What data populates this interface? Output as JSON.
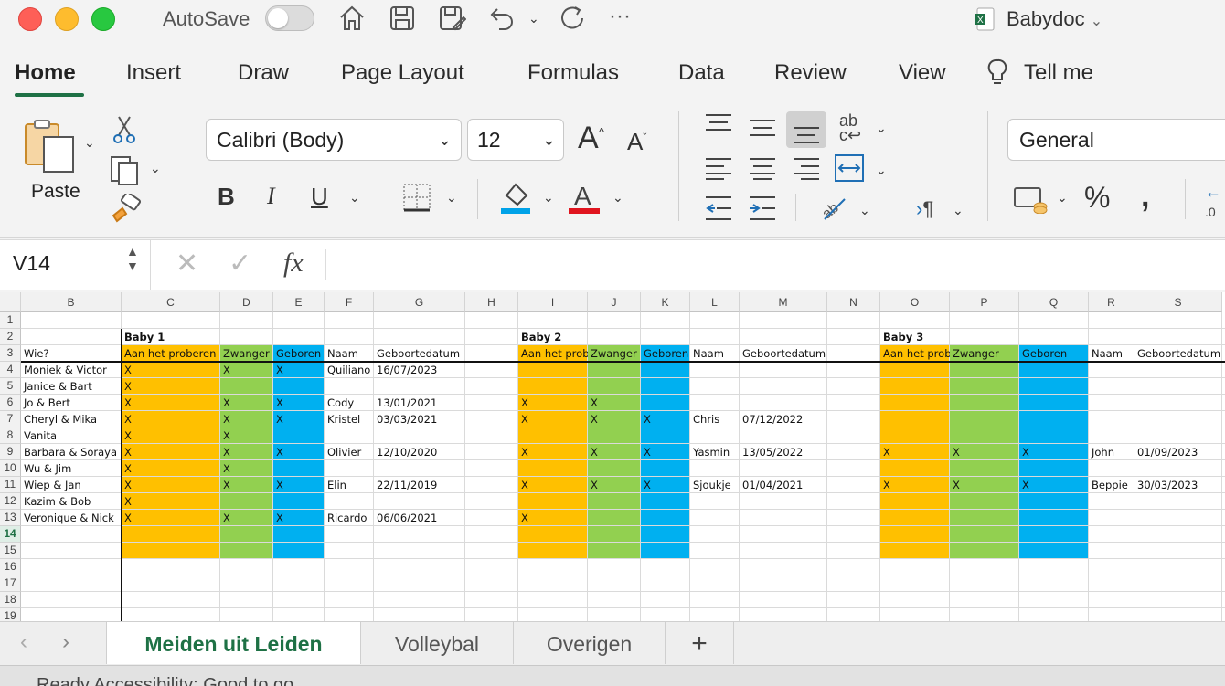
{
  "window": {
    "autosave_label": "AutoSave",
    "doc_title": "Babydoc",
    "ribbon_tabs": [
      "Home",
      "Insert",
      "Draw",
      "Page Layout",
      "Formulas",
      "Data",
      "Review",
      "View",
      "Tell me"
    ]
  },
  "ribbon": {
    "paste_label": "Paste",
    "font_name": "Calibri (Body)",
    "font_size": "12",
    "number_format": "General",
    "underline_color": "#e0141e",
    "fill_color": "#00a2e8"
  },
  "formula_bar": {
    "cell_ref": "V14",
    "fx": "fx",
    "value": ""
  },
  "columns": [
    "B",
    "C",
    "D",
    "E",
    "F",
    "G",
    "H",
    "I",
    "J",
    "K",
    "L",
    "M",
    "N",
    "O",
    "P",
    "Q",
    "R",
    "S"
  ],
  "rows": [
    "1",
    "2",
    "3",
    "4",
    "5",
    "6",
    "7",
    "8",
    "9",
    "10",
    "11",
    "12",
    "13",
    "14",
    "15",
    "16",
    "17",
    "18",
    "19"
  ],
  "selected_row": "14",
  "colors": {
    "orange": "#ffc000",
    "green": "#92d050",
    "blue": "#00b0f0",
    "accent": "#1e7145"
  },
  "cells": {
    "C2": "Baby 1",
    "I2": "Baby 2",
    "O2": "Baby 3",
    "B3": "Wie?",
    "C3": "Aan het proberen",
    "D3": "Zwanger",
    "E3": "Geboren",
    "F3": "Naam",
    "G3": "Geboortedatum",
    "I3": "Aan het proberen",
    "J3": "Zwanger",
    "K3": "Geboren",
    "L3": "Naam",
    "M3": "Geboortedatum",
    "O3": "Aan het proberen",
    "P3": "Zwanger",
    "Q3": "Geboren",
    "R3": "Naam",
    "S3": "Geboortedatum",
    "B4": "Moniek & Victor",
    "C4": "X",
    "D4": "X",
    "E4": "X",
    "F4": "Quiliano",
    "G4": "16/07/2023",
    "B5": "Janice & Bart",
    "C5": "X",
    "B6": "Jo & Bert",
    "C6": "X",
    "D6": "X",
    "E6": "X",
    "F6": "Cody",
    "G6": "13/01/2021",
    "I6": "X",
    "J6": "X",
    "B7": "Cheryl & Mika",
    "C7": "X",
    "D7": "X",
    "E7": "X",
    "F7": "Kristel",
    "G7": "03/03/2021",
    "I7": "X",
    "J7": "X",
    "K7": "X",
    "L7": "Chris",
    "M7": "07/12/2022",
    "B8": "Vanita",
    "C8": "X",
    "D8": "X",
    "B9": "Barbara & Soraya",
    "C9": "X",
    "D9": "X",
    "E9": "X",
    "F9": "Olivier",
    "G9": "12/10/2020",
    "I9": "X",
    "J9": "X",
    "K9": "X",
    "L9": "Yasmin",
    "M9": "13/05/2022",
    "O9": "X",
    "P9": "X",
    "Q9": "X",
    "R9": "John",
    "S9": "01/09/2023",
    "B10": "Wu & Jim",
    "C10": "X",
    "D10": "X",
    "B11": "Wiep & Jan",
    "C11": "X",
    "D11": "X",
    "E11": "X",
    "F11": "Elin",
    "G11": "22/11/2019",
    "I11": "X",
    "J11": "X",
    "K11": "X",
    "L11": "Sjoukje",
    "M11": "01/04/2021",
    "O11": "X",
    "P11": "X",
    "Q11": "X",
    "R11": "Beppie",
    "S11": "30/03/2023",
    "B12": "Kazim & Bob",
    "C12": "X",
    "B13": "Veronique & Nick",
    "C13": "X",
    "D13": "X",
    "E13": "X",
    "F13": "Ricardo",
    "G13": "06/06/2021",
    "I13": "X"
  },
  "sheet_tabs": [
    "Meiden uit Leiden",
    "Volleybal",
    "Overigen"
  ],
  "add_sheet": "+",
  "status": {
    "text": "Ready    Accessibility: Good to go"
  }
}
